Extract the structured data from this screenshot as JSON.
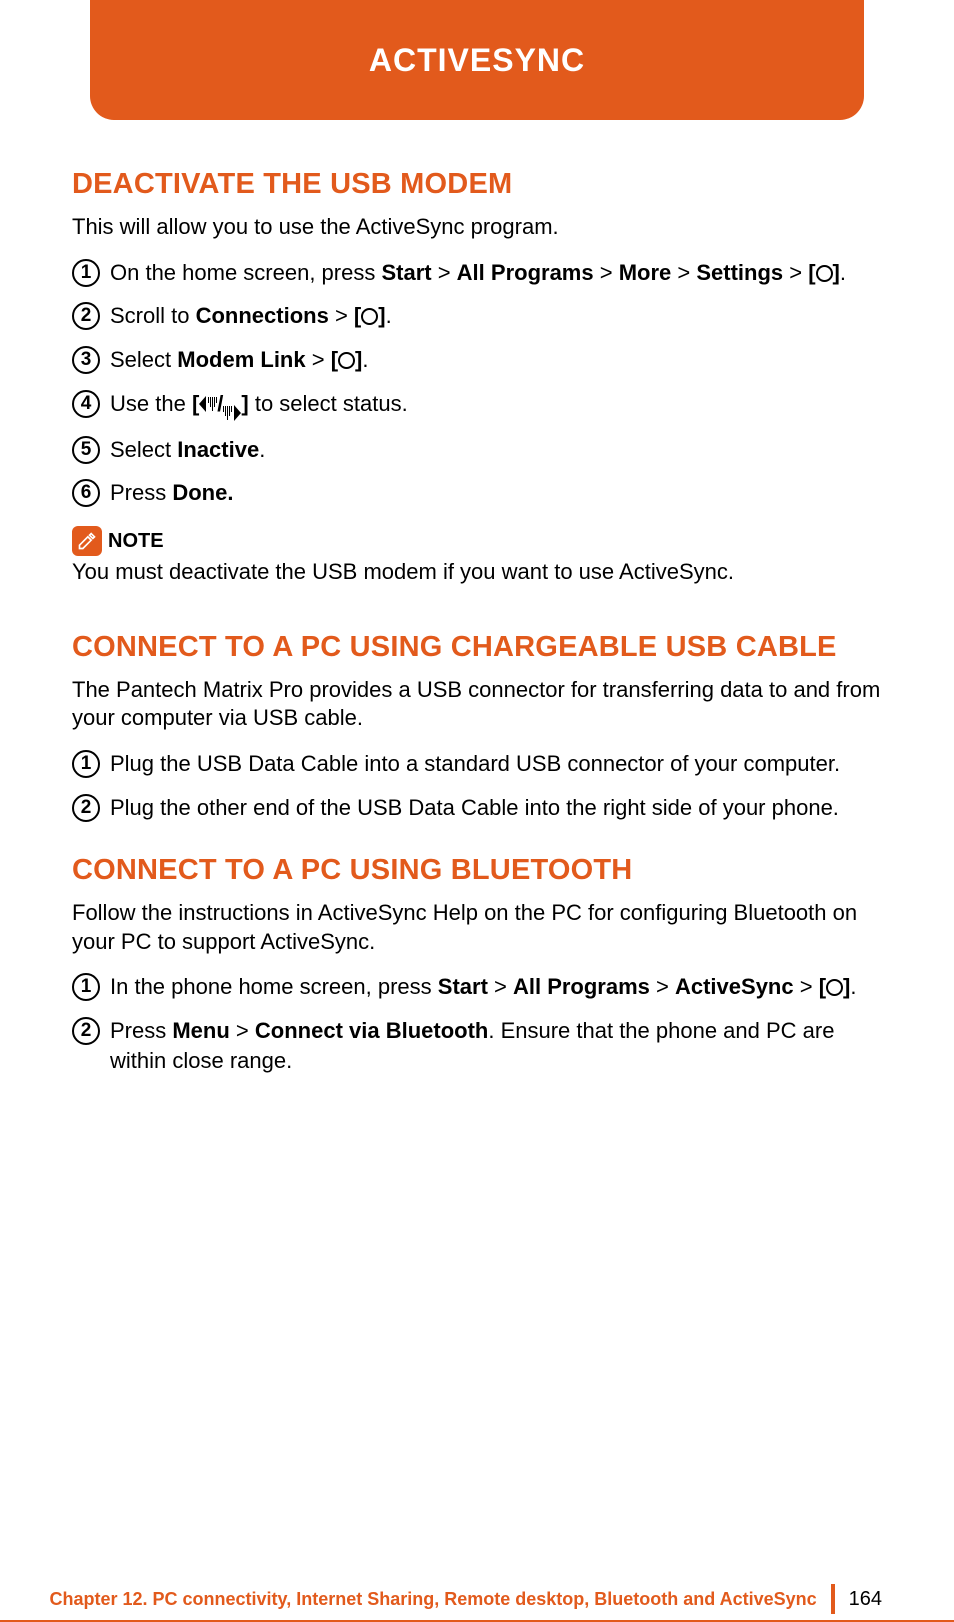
{
  "header": {
    "title": "ACTIVESYNC"
  },
  "section1": {
    "title": "DEACTIVATE THE USB MODEM",
    "intro": "This will allow you to use the ActiveSync program.",
    "steps": {
      "s1": {
        "n": "1",
        "a": "On the home screen, press ",
        "b1": "Start",
        "g1": " > ",
        "b2": "All Programs",
        "g2": " > ",
        "b3": "More",
        "g3": " > ",
        "b4": "Settings",
        "g4": " > ",
        "br1": "[",
        "br2": "]",
        "dot": "."
      },
      "s2": {
        "n": "2",
        "a": "Scroll to ",
        "b1": "Connections",
        "g1": " > ",
        "br1": "[",
        "br2": "]",
        "dot": "."
      },
      "s3": {
        "n": "3",
        "a": "Select ",
        "b1": "Modem Link",
        "g1": " > ",
        "br1": "[",
        "br2": "]",
        "dot": "."
      },
      "s4": {
        "n": "4",
        "a": "Use the ",
        "br1": "[",
        "slash": "/",
        "br2": "]",
        "b": " to select status."
      },
      "s5": {
        "n": "5",
        "a": "Select ",
        "b1": "Inactive",
        "dot": "."
      },
      "s6": {
        "n": "6",
        "a": "Press ",
        "b1": "Done."
      }
    },
    "note": {
      "label": "NOTE",
      "text": "You must deactivate the USB modem if you want to use ActiveSync."
    }
  },
  "section2": {
    "title": "CONNECT TO A PC USING CHARGEABLE USB CABLE",
    "intro": "The Pantech Matrix Pro provides a USB connector for transferring data to and from your computer via USB cable.",
    "steps": {
      "s1": {
        "n": "1",
        "text": "Plug the USB Data Cable into a standard USB connector of your computer."
      },
      "s2": {
        "n": "2",
        "text": "Plug the other end of the USB Data Cable into the right side of your phone."
      }
    }
  },
  "section3": {
    "title": "CONNECT TO A PC USING BLUETOOTH",
    "intro": "Follow the instructions in ActiveSync Help on the PC for configuring Bluetooth on your PC to support ActiveSync.",
    "steps": {
      "s1": {
        "n": "1",
        "a": "In the phone home screen, press ",
        "b1": "Start",
        "g1": " > ",
        "b2": "All Programs",
        "g2": " > ",
        "b3": "ActiveSync",
        "g3": " > ",
        "br1": "[",
        "br2": "]",
        "dot": "."
      },
      "s2": {
        "n": "2",
        "a": "Press ",
        "b1": "Menu",
        "g1": " > ",
        "b2": "Connect via Bluetooth",
        "b": ". Ensure that the phone and PC are within close range."
      }
    }
  },
  "footer": {
    "chapter": "Chapter 12. PC connectivity, Internet Sharing, Remote desktop, Bluetooth and ActiveSync",
    "page": "164"
  }
}
